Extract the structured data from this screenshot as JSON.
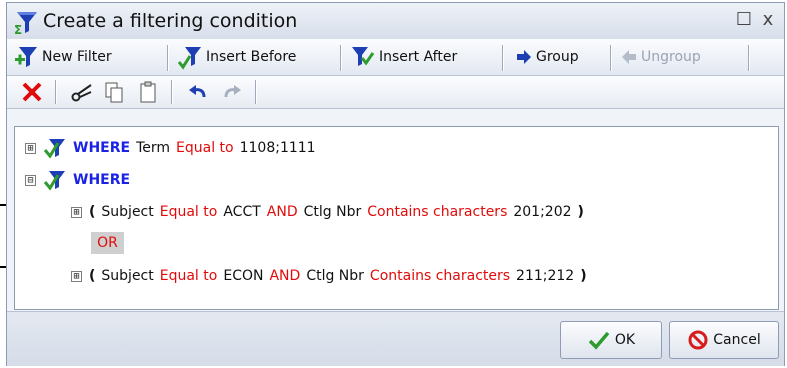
{
  "window": {
    "title": "Create a filtering condition",
    "maximize_glyph": "☐",
    "close_glyph": "x"
  },
  "toolbar": {
    "new_filter": "New Filter",
    "insert_before": "Insert Before",
    "insert_after": "Insert After",
    "group": "Group",
    "ungroup": "Ungroup"
  },
  "edit_toolbar": {
    "icons": [
      "delete-icon",
      "cut-icon",
      "copy-icon",
      "paste-icon",
      "undo-icon",
      "redo-icon"
    ]
  },
  "conditions": [
    {
      "expander": "⊞",
      "keyword": "WHERE",
      "field": "Term",
      "operator": "Equal to",
      "value": "1108;1111"
    },
    {
      "expander": "⊟",
      "keyword": "WHERE",
      "groups": [
        {
          "expander": "⊞",
          "open": "(",
          "field1": "Subject",
          "op1": "Equal to",
          "value1": "ACCT",
          "conj": "AND",
          "field2": "Ctlg Nbr",
          "op2": "Contains characters",
          "value2": "201;202",
          "close": ")"
        },
        {
          "expander": "⊞",
          "open": "(",
          "field1": "Subject",
          "op1": "Equal to",
          "value1": "ECON",
          "conj": "AND",
          "field2": "Ctlg Nbr",
          "op2": "Contains characters",
          "value2": "211;212",
          "close": ")"
        }
      ],
      "or_label": "OR"
    }
  ],
  "footer": {
    "ok": "OK",
    "cancel": "Cancel"
  },
  "colors": {
    "keyword": "#1a23e6",
    "operator": "#e10b0b",
    "accent_green": "#2e9b2e",
    "funnel_blue": "#1d3fb3"
  }
}
